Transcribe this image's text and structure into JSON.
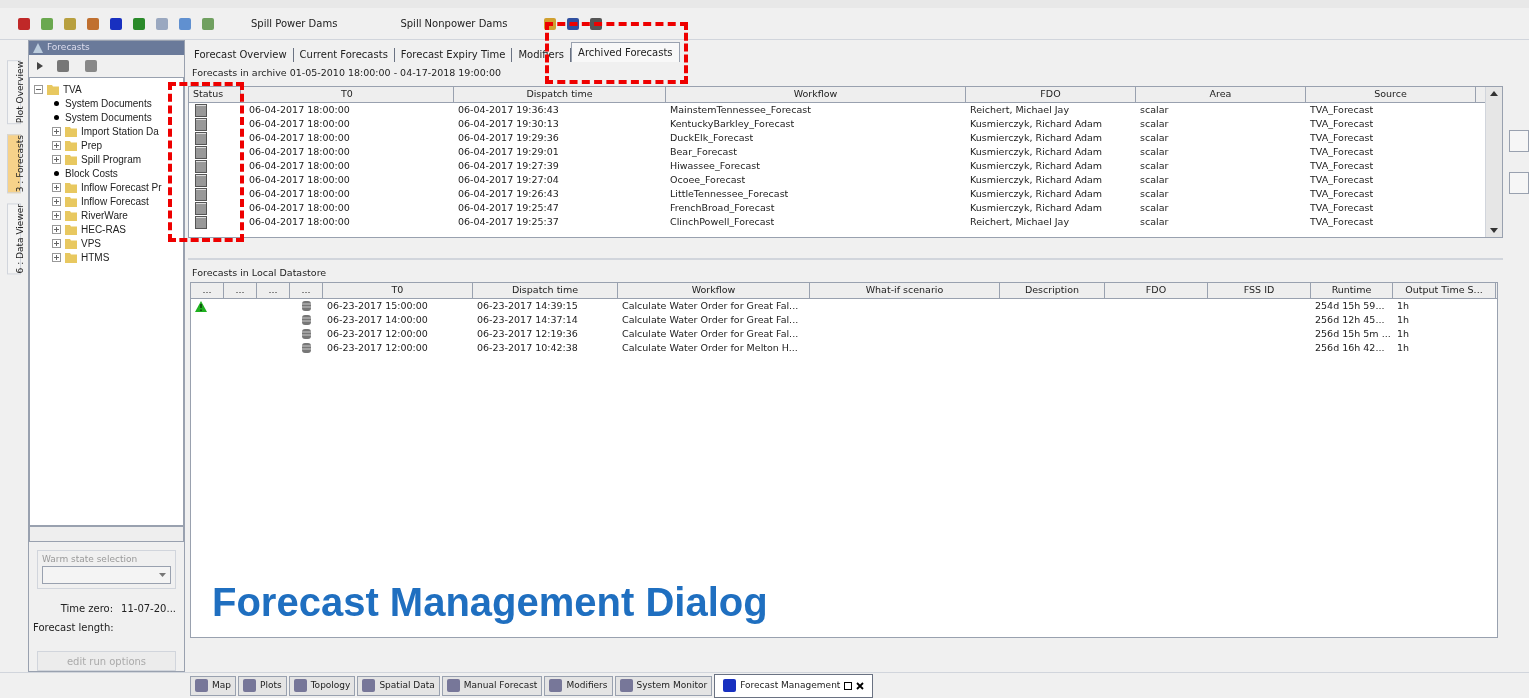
{
  "toolbar": {
    "buttons": [
      "Spill Power Dams",
      "Spill Nonpower Dams"
    ]
  },
  "side_tabs": [
    {
      "label": "Plot Overview",
      "selected": false
    },
    {
      "label": "3 : Forecasts",
      "selected": true
    },
    {
      "label": "6 : Data Viewer",
      "selected": false
    }
  ],
  "forecasts_panel": {
    "title": "Forecasts",
    "tree": [
      {
        "label": "TVA",
        "kind": "folder",
        "expanded": true,
        "children": [
          {
            "label": "System Documents",
            "kind": "leaf"
          },
          {
            "label": "System Documents",
            "kind": "leaf"
          },
          {
            "label": "Import Station Da",
            "kind": "folder",
            "expanded": false
          },
          {
            "label": "Prep",
            "kind": "folder",
            "expanded": false
          },
          {
            "label": "Spill Program",
            "kind": "folder",
            "expanded": false
          },
          {
            "label": "Block Costs",
            "kind": "leaf"
          },
          {
            "label": "Inflow Forecast Pr",
            "kind": "folder",
            "expanded": false
          },
          {
            "label": "Inflow Forecast",
            "kind": "folder",
            "expanded": false
          },
          {
            "label": "RiverWare",
            "kind": "folder",
            "expanded": false
          },
          {
            "label": "HEC-RAS",
            "kind": "folder",
            "expanded": false
          },
          {
            "label": "VPS",
            "kind": "folder",
            "expanded": false
          },
          {
            "label": "HTMS",
            "kind": "folder",
            "expanded": false
          }
        ]
      }
    ],
    "warm_state_label": "Warm state selection",
    "time_zero_label": "Time zero:",
    "time_zero_value": "11-07-20...",
    "forecast_length_label": "Forecast length:",
    "edit_button": {
      "label": "edit run options",
      "disabled": true
    }
  },
  "tabs": [
    {
      "label": "Forecast Overview",
      "selected": false
    },
    {
      "label": "Current Forecasts",
      "selected": false
    },
    {
      "label": "Forecast Expiry Time",
      "selected": false
    },
    {
      "label": "Modifiers",
      "selected": false
    },
    {
      "label": "Archived Forecasts",
      "selected": true
    }
  ],
  "archive": {
    "caption": "Forecasts in archive 01-05-2010 18:00:00 - 04-17-2018 19:00:00",
    "columns": [
      "Status",
      "T0",
      "Dispatch time",
      "Workflow",
      "FDO",
      "Area",
      "Source"
    ],
    "rows": [
      [
        "",
        "06-04-2017 18:00:00",
        "06-04-2017 19:36:43",
        "MainstemTennessee_Forecast",
        "Reichert, Michael Jay",
        "scalar",
        "TVA_Forecast"
      ],
      [
        "",
        "06-04-2017 18:00:00",
        "06-04-2017 19:30:13",
        "KentuckyBarkley_Forecast",
        "Kusmierczyk, Richard Adam",
        "scalar",
        "TVA_Forecast"
      ],
      [
        "",
        "06-04-2017 18:00:00",
        "06-04-2017 19:29:36",
        "DuckElk_Forecast",
        "Kusmierczyk, Richard Adam",
        "scalar",
        "TVA_Forecast"
      ],
      [
        "",
        "06-04-2017 18:00:00",
        "06-04-2017 19:29:01",
        "Bear_Forecast",
        "Kusmierczyk, Richard Adam",
        "scalar",
        "TVA_Forecast"
      ],
      [
        "",
        "06-04-2017 18:00:00",
        "06-04-2017 19:27:39",
        "Hiwassee_Forecast",
        "Kusmierczyk, Richard Adam",
        "scalar",
        "TVA_Forecast"
      ],
      [
        "",
        "06-04-2017 18:00:00",
        "06-04-2017 19:27:04",
        "Ocoee_Forecast",
        "Kusmierczyk, Richard Adam",
        "scalar",
        "TVA_Forecast"
      ],
      [
        "",
        "06-04-2017 18:00:00",
        "06-04-2017 19:26:43",
        "LittleTennessee_Forecast",
        "Kusmierczyk, Richard Adam",
        "scalar",
        "TVA_Forecast"
      ],
      [
        "",
        "06-04-2017 18:00:00",
        "06-04-2017 19:25:47",
        "FrenchBroad_Forecast",
        "Kusmierczyk, Richard Adam",
        "scalar",
        "TVA_Forecast"
      ],
      [
        "",
        "06-04-2017 18:00:00",
        "06-04-2017 19:25:37",
        "ClinchPowell_Forecast",
        "Reichert, Michael Jay",
        "scalar",
        "TVA_Forecast"
      ]
    ]
  },
  "local": {
    "caption": "Forecasts in Local Datastore",
    "columns": [
      "...",
      "...",
      "...",
      "...",
      "T0",
      "Dispatch time",
      "Workflow",
      "What-if scenario",
      "Description",
      "FDO",
      "FSS ID",
      "Runtime",
      "Output Time S..."
    ],
    "rows": [
      {
        "warning": true,
        "cells": [
          "06-23-2017 15:00:00",
          "06-23-2017 14:39:15",
          "Calculate Water Order for Great Fal...",
          "",
          "",
          "",
          "",
          "254d 15h 59...",
          "1h"
        ]
      },
      {
        "warning": false,
        "cells": [
          "06-23-2017 14:00:00",
          "06-23-2017 14:37:14",
          "Calculate Water Order for Great Fal...",
          "",
          "",
          "",
          "",
          "256d 12h 45...",
          "1h"
        ]
      },
      {
        "warning": false,
        "cells": [
          "06-23-2017 12:00:00",
          "06-23-2017 12:19:36",
          "Calculate Water Order for Great Fal...",
          "",
          "",
          "",
          "",
          "256d 15h 5m ...",
          "1h"
        ]
      },
      {
        "warning": false,
        "cells": [
          "06-23-2017 12:00:00",
          "06-23-2017 10:42:38",
          "Calculate Water Order for Melton H...",
          "",
          "",
          "",
          "",
          "256d 16h 42...",
          "1h"
        ]
      }
    ]
  },
  "bottom_tabs": [
    {
      "label": "Map",
      "selected": false
    },
    {
      "label": "Plots",
      "selected": false
    },
    {
      "label": "Topology",
      "selected": false
    },
    {
      "label": "Spatial Data",
      "selected": false
    },
    {
      "label": "Manual Forecast",
      "selected": false
    },
    {
      "label": "Modifiers",
      "selected": false
    },
    {
      "label": "System Monitor",
      "selected": false
    },
    {
      "label": "Forecast Management",
      "selected": true
    }
  ],
  "annotation": {
    "caption": "Forecast Management Dialog"
  }
}
